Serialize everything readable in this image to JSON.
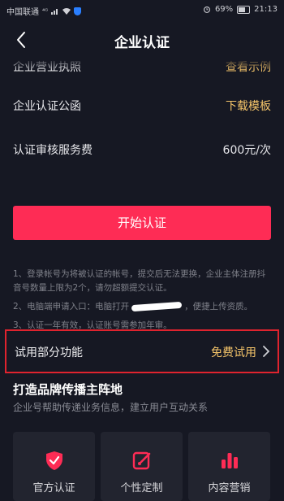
{
  "status_bar": {
    "carrier": "中国联通",
    "signal_text": "⁴ᴳ",
    "battery": "69%",
    "time": "21:13"
  },
  "header": {
    "title": "企业认证"
  },
  "rows": [
    {
      "label": "企业营业执照",
      "value": "查看示例"
    },
    {
      "label": "企业认证公函",
      "value": "下载模板"
    },
    {
      "label": "认证审核服务费",
      "value": "600元/次"
    }
  ],
  "start_button": {
    "label": "开始认证"
  },
  "notes": {
    "note1": "1、登录帐号为将被认证的帐号，提交后无法更换，企业主体注册抖音号数量上限为2个，请勿超额提交认证。",
    "note2_prefix": "2、电脑端申请入口：电脑打开",
    "note2_suffix": "，便捷上传资质。",
    "note3": "3、认证一年有效，认证账号需参加年审。"
  },
  "trial": {
    "label": "试用部分功能",
    "value": "免费试用"
  },
  "section": {
    "title": "打造品牌传播主阵地",
    "subtitle": "企业号帮助传递业务信息，建立用户互动关系"
  },
  "cards": [
    {
      "label": "官方认证",
      "icon": "shield-check-icon"
    },
    {
      "label": "个性定制",
      "icon": "edit-icon"
    },
    {
      "label": "内容营销",
      "icon": "bar-chart-icon"
    }
  ],
  "colors": {
    "background": "#161823",
    "accent": "#fe2c55",
    "gold": "#f5c56a",
    "highlight_border": "#e0232e"
  }
}
